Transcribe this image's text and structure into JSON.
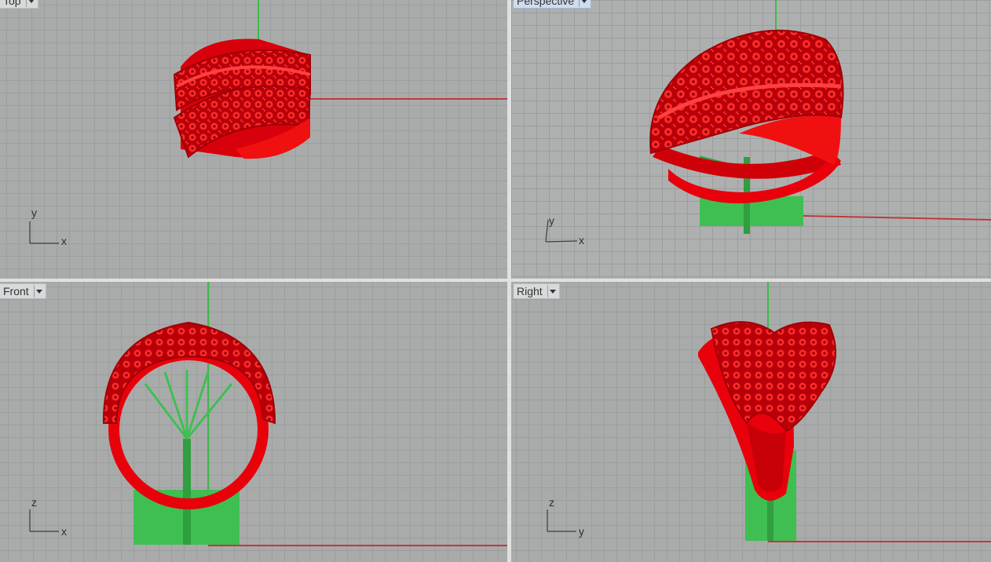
{
  "viewports": {
    "top": {
      "label": "Top",
      "axis_h": "x",
      "axis_v": "y"
    },
    "perspective": {
      "label": "Perspective",
      "axis_h": "x",
      "axis_v": "y"
    },
    "front": {
      "label": "Front",
      "axis_h": "x",
      "axis_v": "z"
    },
    "right": {
      "label": "Right",
      "axis_h": "y",
      "axis_v": "z"
    }
  },
  "colors": {
    "model": "#e8000a",
    "support": "#3fbf52",
    "axis_x": "#c0393b",
    "axis_y": "#3dbb44",
    "grid_bg": "#a9abab"
  },
  "icons": [
    "dropdown-arrow-icon"
  ]
}
